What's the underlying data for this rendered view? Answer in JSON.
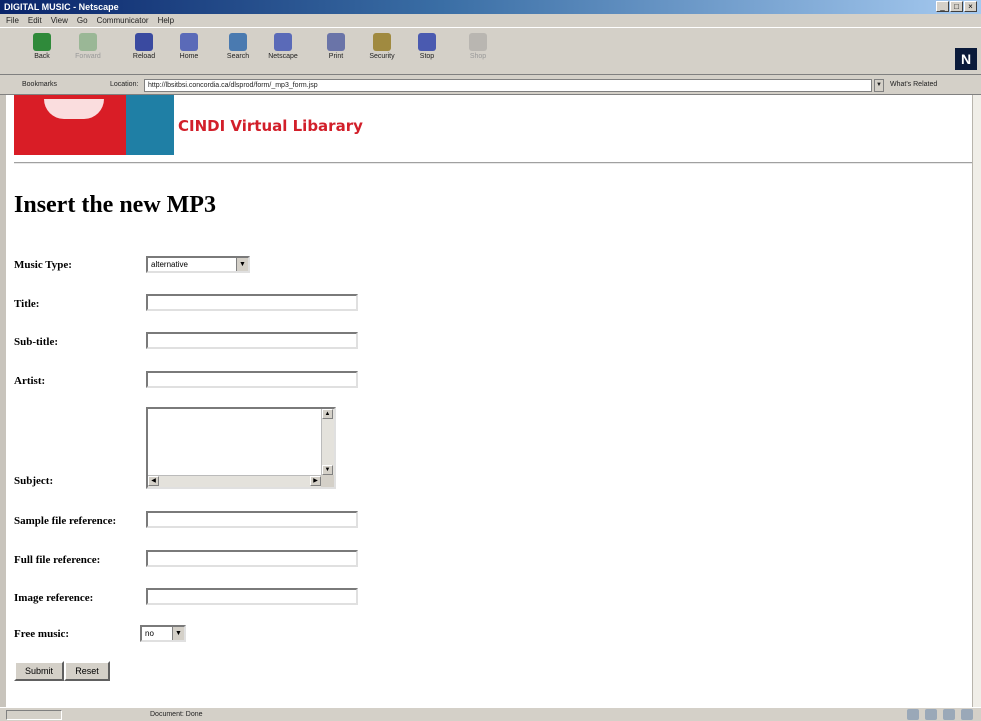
{
  "window": {
    "title": "DIGITAL MUSIC - Netscape",
    "controls": [
      "_",
      "□",
      "×"
    ]
  },
  "menu": [
    "File",
    "Edit",
    "View",
    "Go",
    "Communicator",
    "Help"
  ],
  "toolbar": [
    {
      "label": "Back",
      "icon": "back-arrow-icon",
      "color": "#2f8a3a",
      "enabled": true
    },
    {
      "label": "Forward",
      "icon": "forward-arrow-icon",
      "color": "#2f8a3a",
      "enabled": false
    },
    {
      "label": "Reload",
      "icon": "reload-icon",
      "color": "#3a4aa0",
      "enabled": true
    },
    {
      "label": "Home",
      "icon": "home-icon",
      "color": "#5a6ab8",
      "enabled": true
    },
    {
      "label": "Search",
      "icon": "search-icon",
      "color": "#4a7ab0",
      "enabled": true
    },
    {
      "label": "Netscape",
      "icon": "netscape-icon",
      "color": "#5a6ab8",
      "enabled": true
    },
    {
      "label": "Print",
      "icon": "print-icon",
      "color": "#6a74a8",
      "enabled": true
    },
    {
      "label": "Security",
      "icon": "lock-icon",
      "color": "#a08a40",
      "enabled": true
    },
    {
      "label": "Stop",
      "icon": "stop-icon",
      "color": "#4a5ab0",
      "enabled": true
    },
    {
      "label": "Shop",
      "icon": "shop-icon",
      "color": "#888888",
      "enabled": false
    }
  ],
  "location": {
    "bookmarks_label": "Bookmarks",
    "location_label": "Location:",
    "url": "http://lbsitbsi.concordia.ca/dlsprod/form/_mp3_form.jsp",
    "related_label": "What's Related"
  },
  "site": {
    "title": "CINDI Virtual Libarary"
  },
  "form": {
    "heading": "Insert the new MP3",
    "music_type": {
      "label": "Music Type:",
      "value": "alternative"
    },
    "title": {
      "label": "Title:",
      "value": ""
    },
    "subtitle": {
      "label": "Sub-title:",
      "value": ""
    },
    "artist": {
      "label": "Artist:",
      "value": ""
    },
    "subject": {
      "label": "Subject:",
      "value": ""
    },
    "sample_file": {
      "label": "Sample file reference:",
      "value": ""
    },
    "full_file": {
      "label": "Full file reference:",
      "value": ""
    },
    "image_ref": {
      "label": "Image reference:",
      "value": ""
    },
    "free_music": {
      "label": "Free music:",
      "value": "no"
    },
    "submit_label": "Submit",
    "reset_label": "Reset"
  },
  "status": {
    "message": "Document: Done"
  },
  "colors": {
    "brand_red": "#d91d26",
    "brand_teal": "#1f7fa5",
    "title_red": "#d21f2a"
  }
}
